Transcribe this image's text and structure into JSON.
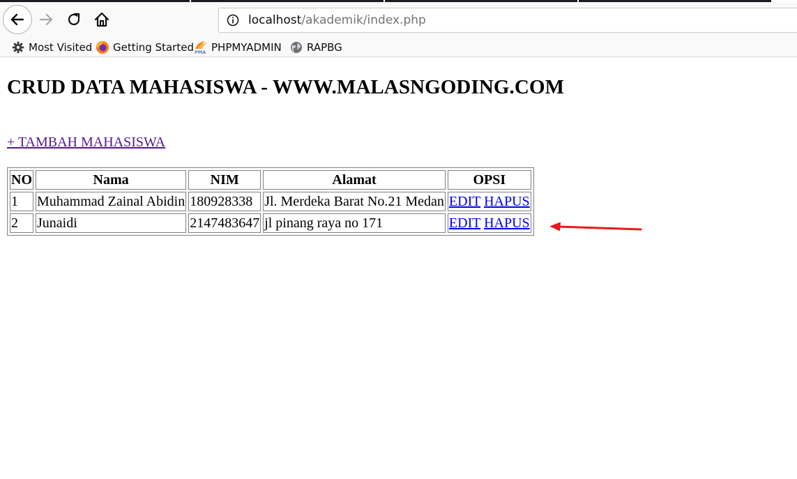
{
  "browser": {
    "url_host": "localhost",
    "url_path": "/akademik/index.php",
    "bookmarks": [
      {
        "label": "Most Visited",
        "icon": "gear-icon"
      },
      {
        "label": "Getting Started",
        "icon": "firefox-icon"
      },
      {
        "label": "PHPMYADMIN",
        "icon": "phpmyadmin-icon"
      },
      {
        "label": "RAPBG",
        "icon": "globe-icon"
      }
    ]
  },
  "page": {
    "title": "CRUD DATA MAHASISWA - WWW.MALASNGODING.COM",
    "add_link": "+ TAMBAH MAHASISWA",
    "table": {
      "headers": [
        "NO",
        "Nama",
        "NIM",
        "Alamat",
        "OPSI"
      ],
      "rows": [
        {
          "no": "1",
          "nama": "Muhammad Zainal Abidin",
          "nim": "180928338",
          "alamat": "Jl. Merdeka Barat No.21 Medan",
          "edit": "EDIT",
          "hapus": "HAPUS"
        },
        {
          "no": "2",
          "nama": "Junaidi",
          "nim": "2147483647",
          "alamat": "jl pinang raya no 171",
          "edit": "EDIT",
          "hapus": "HAPUS"
        }
      ]
    }
  },
  "colors": {
    "visited_link": "#551a8b",
    "link": "#0000ee",
    "annotation_arrow": "#e8191b"
  }
}
